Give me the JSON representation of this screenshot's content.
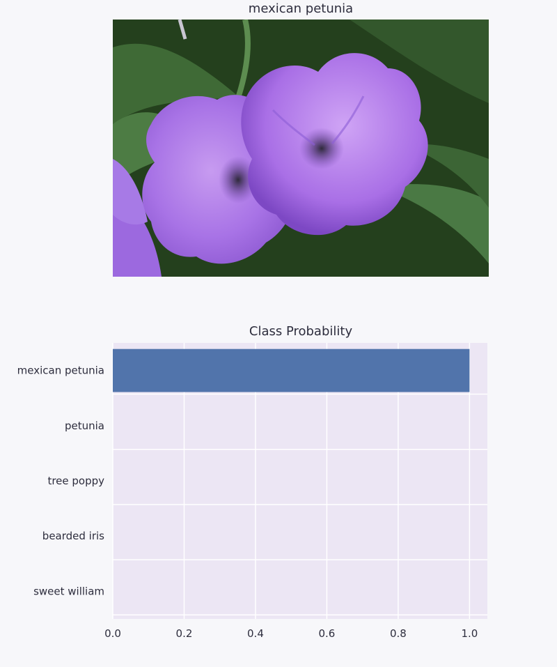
{
  "image_panel": {
    "title": "mexican petunia",
    "image_description": "photo of purple mexican petunia flowers on dark green foliage"
  },
  "colors": {
    "bar": "#5174ab",
    "plot_bg": "#ece6f4",
    "grid": "#ffffff",
    "page_bg": "#f7f7fa"
  },
  "chart_data": {
    "type": "bar",
    "orientation": "horizontal",
    "title": "Class Probability",
    "categories": [
      "mexican petunia",
      "petunia",
      "tree poppy",
      "bearded iris",
      "sweet william"
    ],
    "values": [
      1.0,
      0.0,
      0.0,
      0.0,
      0.0
    ],
    "xlim": [
      0.0,
      1.05
    ],
    "xticks": [
      "0.0",
      "0.2",
      "0.4",
      "0.6",
      "0.8",
      "1.0"
    ],
    "xtick_values": [
      0.0,
      0.2,
      0.4,
      0.6,
      0.8,
      1.0
    ],
    "xlabel": "",
    "ylabel": "",
    "grid": true
  }
}
